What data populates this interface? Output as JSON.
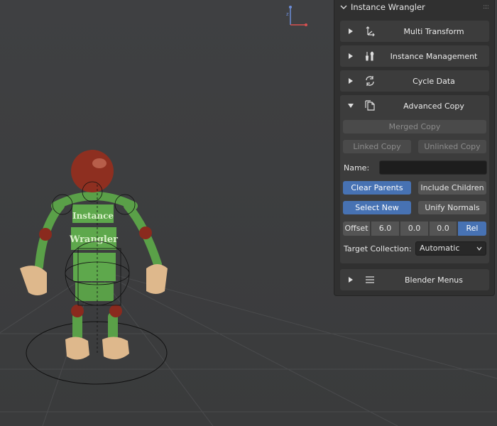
{
  "viewport": {
    "model_label_top": "Instance",
    "model_label_bottom": "Wrangler"
  },
  "panel": {
    "title": "Instance Wrangler",
    "sections": [
      {
        "label": "Multi Transform",
        "icon": "transform-icon",
        "expanded": false
      },
      {
        "label": "Instance Management",
        "icon": "tools-icon",
        "expanded": false
      },
      {
        "label": "Cycle Data",
        "icon": "cycle-icon",
        "expanded": false
      },
      {
        "label": "Advanced Copy",
        "icon": "copy-icon",
        "expanded": true
      },
      {
        "label": "Blender Menus",
        "icon": "menu-icon",
        "expanded": false
      }
    ],
    "advanced_copy": {
      "merged_copy": "Merged Copy",
      "linked_copy": "Linked Copy",
      "unlinked_copy": "Unlinked Copy",
      "name_label": "Name:",
      "name_value": "",
      "clear_parents": "Clear Parents",
      "include_children": "Include Children",
      "select_new": "Select New",
      "unify_normals": "Unify Normals",
      "offset_label": "Offset",
      "offset_x": "6.0",
      "offset_y": "0.0",
      "offset_z": "0.0",
      "rel_label": "Rel",
      "target_collection_label": "Target Collection:",
      "target_collection_value": "Automatic"
    }
  },
  "colors": {
    "accent_blue": "#4772b3",
    "panel_bg": "#303030",
    "section_bg": "#3c3c3c",
    "button_bg": "#545454"
  }
}
